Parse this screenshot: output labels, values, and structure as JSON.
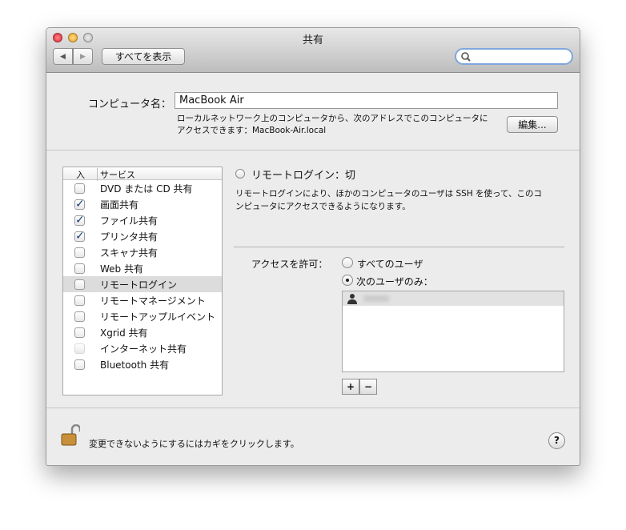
{
  "window": {
    "title": "共有"
  },
  "toolbar": {
    "back": "◀",
    "forward": "▶",
    "show_all": "すべてを表示",
    "search_placeholder": ""
  },
  "computer_name": {
    "label": "コンピュータ名：",
    "value": "MacBook Air",
    "desc_line1": "ローカルネットワーク上のコンピュータから、次のアドレスでこのコンピュータに",
    "desc_line2": "アクセスできます：MacBook-Air.local",
    "edit": "編集..."
  },
  "services": {
    "col_on": "入",
    "col_service": "サービス",
    "items": [
      {
        "label": "DVD または CD 共有",
        "checked": false
      },
      {
        "label": "画面共有",
        "checked": true
      },
      {
        "label": "ファイル共有",
        "checked": true
      },
      {
        "label": "プリンタ共有",
        "checked": true
      },
      {
        "label": "スキャナ共有",
        "checked": false
      },
      {
        "label": "Web 共有",
        "checked": false
      },
      {
        "label": "リモートログイン",
        "checked": false,
        "selected": true
      },
      {
        "label": "リモートマネージメント",
        "checked": false
      },
      {
        "label": "リモートアップルイベント",
        "checked": false
      },
      {
        "label": "Xgrid 共有",
        "checked": false
      },
      {
        "label": "インターネット共有",
        "checked": false,
        "disabled": true
      },
      {
        "label": "Bluetooth 共有",
        "checked": false
      }
    ]
  },
  "detail": {
    "status": "リモートログイン：切",
    "desc_line1": "リモートログインにより、ほかのコンピュータのユーザは SSH を使って、このコ",
    "desc_line2": "ンピュータにアクセスできるようになります。",
    "access_label": "アクセスを許可：",
    "opt_all": "すべてのユーザ",
    "opt_only": "次のユーザのみ：",
    "selected_option": "only",
    "add": "+",
    "remove": "−"
  },
  "footer": {
    "lock_text": "変更できないようにするにはカギをクリックします。",
    "help": "?"
  }
}
